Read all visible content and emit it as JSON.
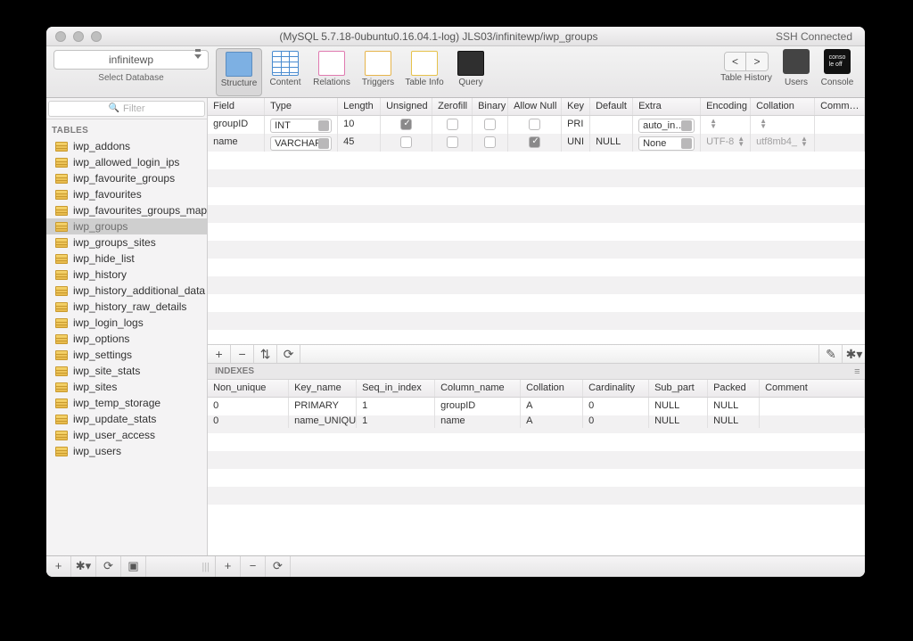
{
  "titlebar": {
    "title": "(MySQL 5.7.18-0ubuntu0.16.04.1-log) JLS03/infinitewp/iwp_groups",
    "ssh": "SSH Connected"
  },
  "toolbar": {
    "db_selected": "infinitewp",
    "db_select_label": "Select Database",
    "buttons": {
      "structure": "Structure",
      "content": "Content",
      "relations": "Relations",
      "triggers": "Triggers",
      "tableinfo": "Table Info",
      "query": "Query"
    },
    "right": {
      "history": "Table History",
      "users": "Users",
      "console": "Console",
      "console_text": "conso\nle off"
    }
  },
  "sidebar": {
    "filter_placeholder": "Filter",
    "tables_label": "TABLES",
    "tables": [
      "iwp_addons",
      "iwp_allowed_login_ips",
      "iwp_favourite_groups",
      "iwp_favourites",
      "iwp_favourites_groups_map",
      "iwp_groups",
      "iwp_groups_sites",
      "iwp_hide_list",
      "iwp_history",
      "iwp_history_additional_data",
      "iwp_history_raw_details",
      "iwp_login_logs",
      "iwp_options",
      "iwp_settings",
      "iwp_site_stats",
      "iwp_sites",
      "iwp_temp_storage",
      "iwp_update_stats",
      "iwp_user_access",
      "iwp_users"
    ],
    "selected": "iwp_groups"
  },
  "columns_header": {
    "field": "Field",
    "type": "Type",
    "length": "Length",
    "unsigned": "Unsigned",
    "zerofill": "Zerofill",
    "binary": "Binary",
    "allow_null": "Allow Null",
    "key": "Key",
    "default": "Default",
    "extra": "Extra",
    "encoding": "Encoding",
    "collation": "Collation",
    "comment": "Comm…"
  },
  "columns": [
    {
      "field": "groupID",
      "type": "INT",
      "length": "10",
      "unsigned": true,
      "zerofill": false,
      "binary": false,
      "allow_null": false,
      "key": "PRI",
      "default": "",
      "extra": "auto_in…",
      "encoding": "",
      "collation": "",
      "comment": ""
    },
    {
      "field": "name",
      "type": "VARCHAR",
      "length": "45",
      "unsigned": false,
      "zerofill": false,
      "binary": false,
      "allow_null": true,
      "key": "UNI",
      "default": "NULL",
      "extra": "None",
      "encoding": "UTF-8",
      "collation": "utf8mb4_",
      "comment": ""
    }
  ],
  "mid_toolbar": {
    "add": "+",
    "remove": "−",
    "dup": "⇅",
    "refresh": "⟳",
    "edit": "✎",
    "gear": "✱▾"
  },
  "indexes_label": "INDEXES",
  "indexes_header": {
    "non_unique": "Non_unique",
    "key_name": "Key_name",
    "seq": "Seq_in_index",
    "col": "Column_name",
    "collation": "Collation",
    "cardinality": "Cardinality",
    "sub_part": "Sub_part",
    "packed": "Packed",
    "comment": "Comment"
  },
  "indexes": [
    {
      "non_unique": "0",
      "key_name": "PRIMARY",
      "seq": "1",
      "col": "groupID",
      "collation": "A",
      "cardinality": "0",
      "sub_part": "NULL",
      "packed": "NULL",
      "comment": ""
    },
    {
      "non_unique": "0",
      "key_name": "name_UNIQUE",
      "seq": "1",
      "col": "name",
      "collation": "A",
      "cardinality": "0",
      "sub_part": "NULL",
      "packed": "NULL",
      "comment": ""
    }
  ],
  "bottom": {
    "add": "+",
    "gear": "✱▾",
    "refresh": "⟳",
    "view": "▣"
  }
}
